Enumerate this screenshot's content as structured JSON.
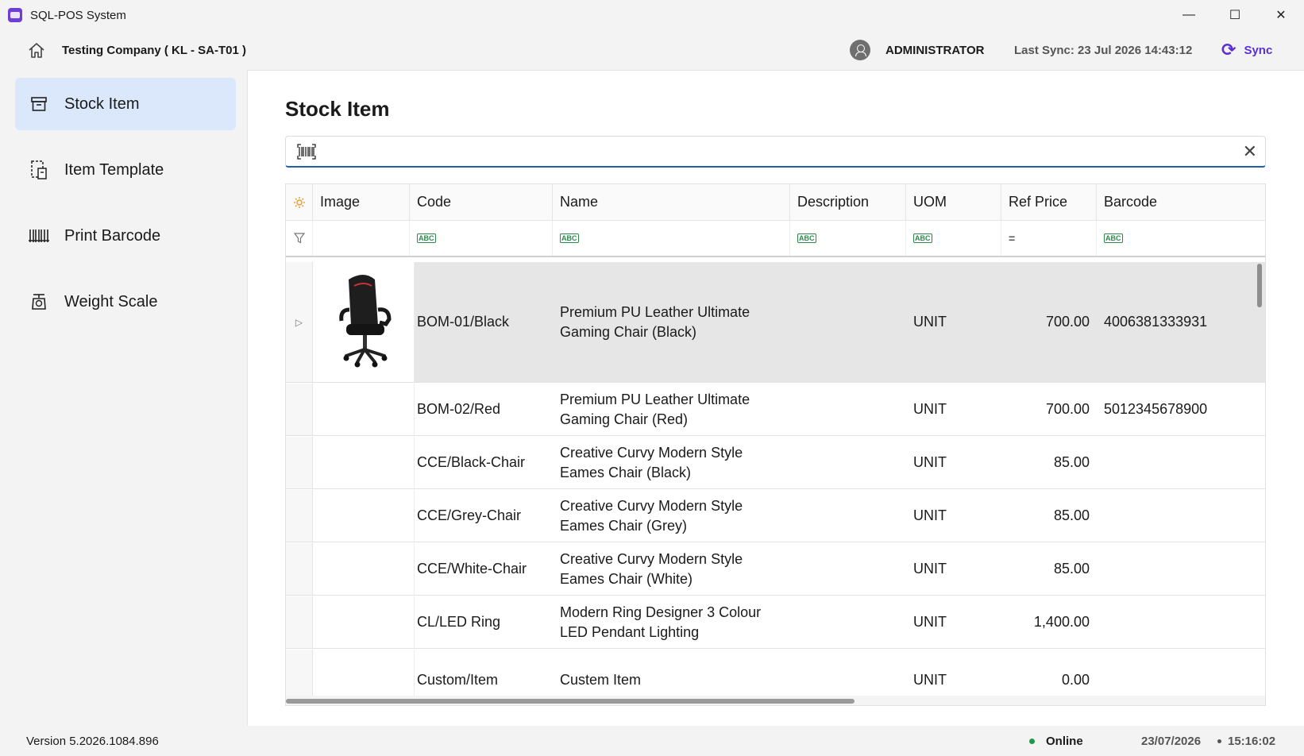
{
  "window": {
    "title": "SQL-POS System",
    "minimize": "—",
    "maximize": "☐",
    "close": "✕"
  },
  "header": {
    "company": "Testing Company ( KL - SA-T01 )",
    "user": "ADMINISTRATOR",
    "last_sync": "Last Sync: 23 Jul 2026 14:43:12",
    "sync_label": "Sync",
    "sync_icon": "⟳"
  },
  "sidebar": {
    "items": [
      {
        "label": "Stock Item",
        "icon": "archive-box-icon",
        "active": true
      },
      {
        "label": "Item Template",
        "icon": "template-icon",
        "active": false
      },
      {
        "label": "Print Barcode",
        "icon": "barcode-icon",
        "active": false
      },
      {
        "label": "Weight Scale",
        "icon": "scale-icon",
        "active": false
      }
    ],
    "version": "Version 5.2026.1084.896"
  },
  "main": {
    "title": "Stock Item",
    "search": {
      "value": "",
      "placeholder": "",
      "clear_icon": "✕"
    }
  },
  "grid": {
    "columns": [
      "Image",
      "Code",
      "Name",
      "Description",
      "UOM",
      "Ref Price",
      "Barcode"
    ],
    "filter_abc": "ABC",
    "filter_eq": "=",
    "expand_icon": "▷",
    "rows": [
      {
        "code": "BOM-01/Black",
        "name": "Premium PU Leather Ultimate Gaming Chair (Black)",
        "description": "",
        "uom": "UNIT",
        "ref_price": "700.00",
        "barcode": "4006381333931",
        "has_image": true
      },
      {
        "code": "BOM-02/Red",
        "name": "Premium PU Leather Ultimate Gaming Chair (Red)",
        "description": "",
        "uom": "UNIT",
        "ref_price": "700.00",
        "barcode": "5012345678900",
        "has_image": false
      },
      {
        "code": "CCE/Black-Chair",
        "name": "Creative Curvy Modern Style Eames Chair (Black)",
        "description": "",
        "uom": "UNIT",
        "ref_price": "85.00",
        "barcode": "",
        "has_image": false
      },
      {
        "code": "CCE/Grey-Chair",
        "name": "Creative Curvy Modern Style Eames Chair (Grey)",
        "description": "",
        "uom": "UNIT",
        "ref_price": "85.00",
        "barcode": "",
        "has_image": false
      },
      {
        "code": "CCE/White-Chair",
        "name": "Creative Curvy Modern Style Eames Chair (White)",
        "description": "",
        "uom": "UNIT",
        "ref_price": "85.00",
        "barcode": "",
        "has_image": false
      },
      {
        "code": "CL/LED Ring",
        "name": "Modern Ring Designer 3 Colour LED Pendant Lighting",
        "description": "",
        "uom": "UNIT",
        "ref_price": "1,400.00",
        "barcode": "",
        "has_image": false
      },
      {
        "code": "Custom/Item",
        "name": "Custem Item",
        "description": "",
        "uom": "UNIT",
        "ref_price": "0.00",
        "barcode": "",
        "has_image": false
      }
    ]
  },
  "status": {
    "online": "Online",
    "date": "23/07/2026",
    "time": "15:16:02"
  },
  "colors": {
    "accent": "#5b2fd6",
    "active_nav": "#dbe8fb",
    "online": "#1f9a4a",
    "selected_row": "#e6e6e6"
  }
}
